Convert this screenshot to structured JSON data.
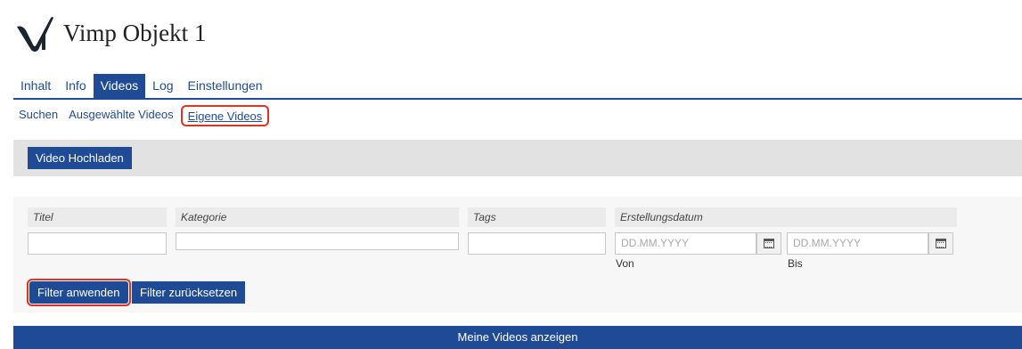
{
  "header": {
    "title": "Vimp Objekt 1",
    "logo_icon": "vimp-logo-icon"
  },
  "tabs": [
    {
      "label": "Inhalt",
      "active": false
    },
    {
      "label": "Info",
      "active": false
    },
    {
      "label": "Videos",
      "active": true
    },
    {
      "label": "Log",
      "active": false
    },
    {
      "label": "Einstellungen",
      "active": false
    }
  ],
  "subtabs": [
    {
      "label": "Suchen"
    },
    {
      "label": "Ausgewählte Videos"
    },
    {
      "label": "Eigene Videos",
      "selected": true
    }
  ],
  "toolbar": {
    "upload_label": "Video Hochladen"
  },
  "filter": {
    "title_label": "Titel",
    "title_value": "",
    "category_label": "Kategorie",
    "category_value": "",
    "tags_label": "Tags",
    "tags_value": "",
    "date_label": "Erstellungsdatum",
    "from_placeholder": "DD.MM.YYYY",
    "from_caption": "Von",
    "to_placeholder": "DD.MM.YYYY",
    "to_caption": "Bis",
    "apply_label": "Filter anwenden",
    "reset_label": "Filter zurücksetzen",
    "calendar_icon": "calendar-icon"
  },
  "footer": {
    "show_label": "Meine Videos anzeigen"
  },
  "colors": {
    "accent": "#1f4b96",
    "highlight": "#e0331f",
    "toolbar_bg": "#e2e2e2"
  }
}
